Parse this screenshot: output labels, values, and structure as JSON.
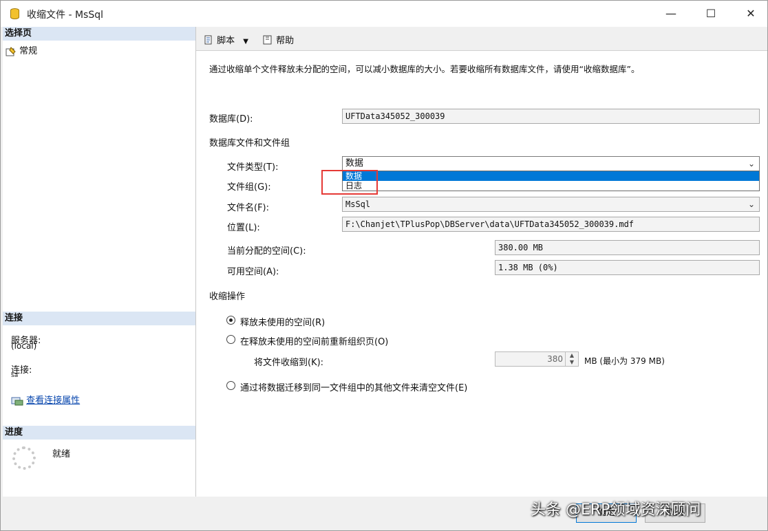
{
  "window": {
    "title": "收缩文件 - MsSql",
    "minimize_icon": "—",
    "maximize_icon": "☐",
    "close_icon": "✕"
  },
  "left": {
    "select_page": {
      "header": "选择页",
      "items": [
        {
          "label": "常规"
        }
      ]
    },
    "connection": {
      "header": "连接",
      "server_label": "服务器:",
      "server_value": "(local)",
      "connect_label": "连接:",
      "connect_value": "sa",
      "view_link": "查看连接属性"
    },
    "progress": {
      "header": "进度",
      "status": "就绪"
    }
  },
  "toolbar": {
    "script_label": "脚本",
    "help_label": "帮助"
  },
  "main": {
    "description": "通过收缩单个文件释放未分配的空间，可以减小数据库的大小。若要收缩所有数据库文件，请使用“收缩数据库”。",
    "database_label": "数据库(D):",
    "database_value": "UFTData345052_300039",
    "files_group_heading": "数据库文件和文件组",
    "file_type_label": "文件类型(T):",
    "file_type_value": "数据",
    "file_type_options": [
      "数据",
      "日志"
    ],
    "filegroup_label": "文件组(G):",
    "filename_label": "文件名(F):",
    "filename_value": "MsSql",
    "location_label": "位置(L):",
    "location_value": "F:\\Chanjet\\TPlusPop\\DBServer\\data\\UFTData345052_300039.mdf",
    "allocated_label": "当前分配的空间(C):",
    "allocated_value": "380.00 MB",
    "available_label": "可用空间(A):",
    "available_value": "1.38 MB (0%)",
    "shrink_heading": "收缩操作",
    "options": [
      {
        "label": "释放未使用的空间(R)",
        "checked": true
      },
      {
        "label": "在释放未使用的空间前重新组织页(O)",
        "checked": false
      },
      {
        "label": "通过将数据迁移到同一文件组中的其他文件来清空文件(E)",
        "checked": false
      }
    ],
    "shrink_to_label": "将文件收缩到(K):",
    "shrink_to_value": "380",
    "shrink_to_unit": "MB (最小为 379 MB)"
  },
  "buttons": {
    "ok": "确定",
    "cancel": "取消"
  },
  "watermark": "头条 @ERP领域资深顾问"
}
